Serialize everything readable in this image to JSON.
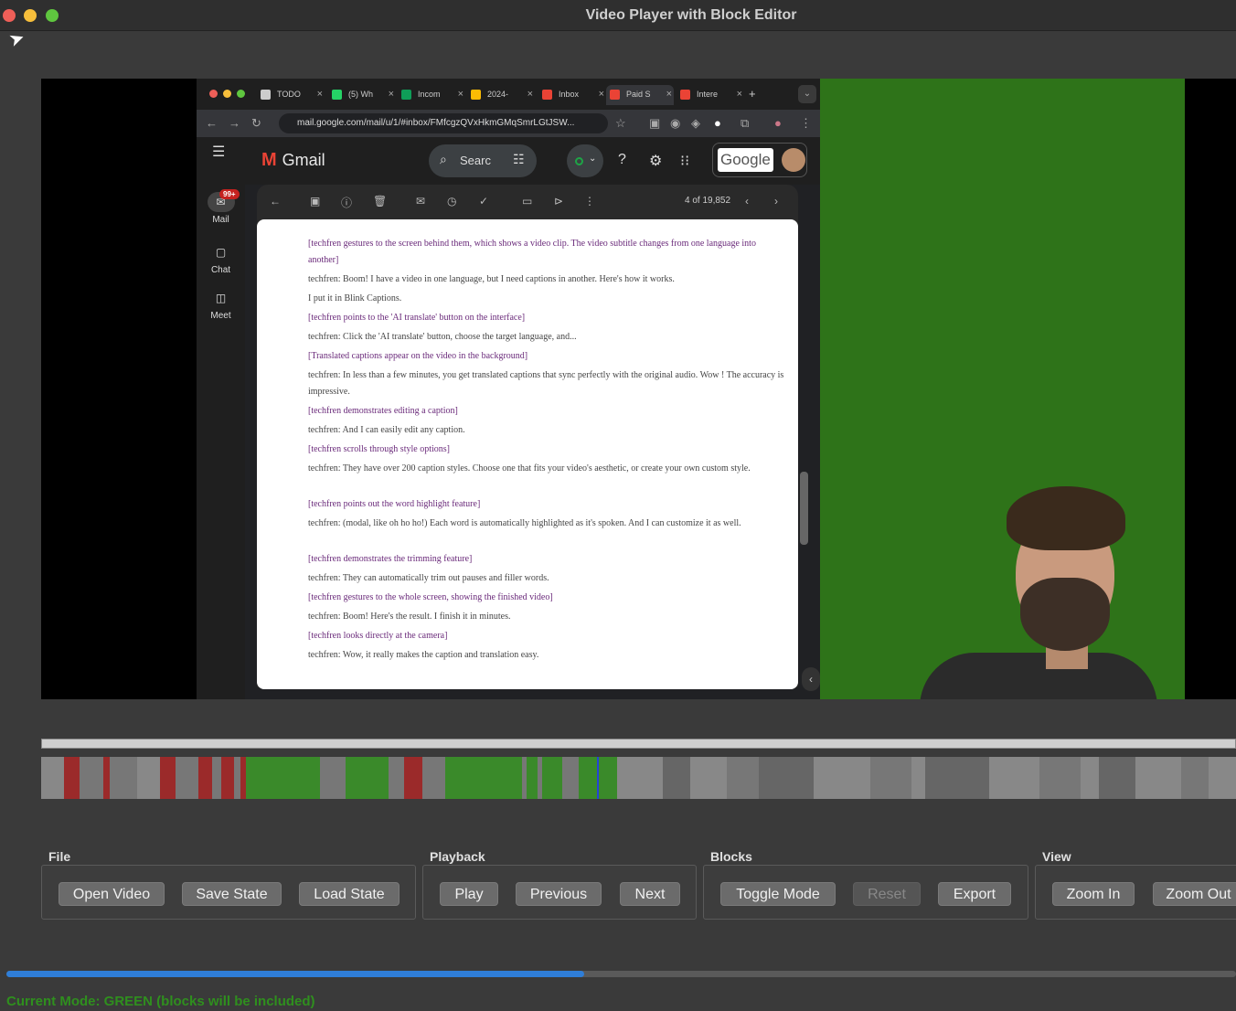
{
  "window": {
    "title": "Video Player with Block Editor"
  },
  "browser": {
    "tabs": [
      {
        "label": "TODO",
        "favicon_color": "#cccccc"
      },
      {
        "label": "(5) Wh",
        "favicon_color": "#25d366"
      },
      {
        "label": "Incom",
        "favicon_color": "#0f9d58"
      },
      {
        "label": "2024-",
        "favicon_color": "#fbbc04"
      },
      {
        "label": "Inbox",
        "favicon_color": "#ea4335"
      },
      {
        "label": "Paid S",
        "favicon_color": "#ea4335"
      },
      {
        "label": "Intere",
        "favicon_color": "#ea4335"
      }
    ],
    "url": "mail.google.com/mail/u/1/#inbox/FMfcgzQVxHkmGMqSmrLGtJSW..."
  },
  "gmail": {
    "logo_text": "Gmail",
    "search_placeholder": "Searc",
    "google_label": "Google",
    "sidebar": [
      {
        "label": "Mail",
        "badge": "99+",
        "icon": "mail-icon"
      },
      {
        "label": "Chat",
        "icon": "chat-icon"
      },
      {
        "label": "Meet",
        "icon": "meet-icon"
      }
    ],
    "pagination": "4 of 19,852",
    "email_lines": [
      {
        "text": "[techfren gestures to the screen behind them, which shows a video clip. The video subtitle changes from one language into another]",
        "action": true
      },
      {
        "text": "techfren: Boom! I have a video in one language, but I need captions in another. Here's how it works.",
        "action": false
      },
      {
        "text": "I put it in Blink Captions.",
        "action": false
      },
      {
        "text": "[techfren points to the 'AI translate' button on the interface]",
        "action": true
      },
      {
        "text": "techfren: Click the 'AI translate' button, choose the target language, and...",
        "action": false
      },
      {
        "text": "[Translated captions appear on the video in the background]",
        "action": true
      },
      {
        "text": "techfren: In less than a few minutes, you get translated captions that sync perfectly with the original audio. Wow ! The accuracy is impressive.",
        "action": false
      },
      {
        "text": "[techfren demonstrates editing a caption]",
        "action": true
      },
      {
        "text": "techfren: And I can easily edit any caption.",
        "action": false
      },
      {
        "text": "[techfren scrolls through style options]",
        "action": true
      },
      {
        "text": "techfren: They have over 200 caption styles. Choose one that fits your video's aesthetic, or create your own custom style.",
        "action": false
      },
      {
        "text": "[techfren points out the word highlight feature]",
        "action": true
      },
      {
        "text": "techfren: (modal, like oh ho ho!) Each word is automatically highlighted as it's spoken. And I can customize it as well.",
        "action": false
      },
      {
        "text": "[techfren demonstrates the trimming feature]",
        "action": true
      },
      {
        "text": "techfren: They can automatically trim out pauses and filler words.",
        "action": false
      },
      {
        "text": "[techfren gestures to the whole screen, showing the finished video]",
        "action": true
      },
      {
        "text": "techfren: Boom! Here's the result. I finish it in minutes.",
        "action": false
      },
      {
        "text": "[techfren looks directly at the camera]",
        "action": true
      },
      {
        "text": "techfren: Wow, it really makes the caption and translation easy.",
        "action": false
      }
    ]
  },
  "timeline": {
    "colors": {
      "red": "#9b2a2a",
      "green": "#3a8a2a",
      "gray": "#777777",
      "darkgray": "#666666",
      "light": "#888888"
    },
    "playhead_fraction": 0.465
  },
  "controls": {
    "groups": [
      {
        "label": "File",
        "buttons": [
          "Open Video",
          "Save State",
          "Load State"
        ]
      },
      {
        "label": "Playback",
        "buttons": [
          "Play",
          "Previous",
          "Next"
        ]
      },
      {
        "label": "Blocks",
        "buttons": [
          "Toggle Mode",
          "Reset",
          "Export"
        ],
        "disabled": [
          "Reset"
        ]
      },
      {
        "label": "View",
        "buttons": [
          "Zoom In",
          "Zoom Out"
        ]
      }
    ]
  },
  "progress": {
    "fraction": 0.47
  },
  "status": {
    "mode_text": "Current Mode: GREEN (blocks will be included)",
    "mode_color": "#2f8f1e"
  }
}
